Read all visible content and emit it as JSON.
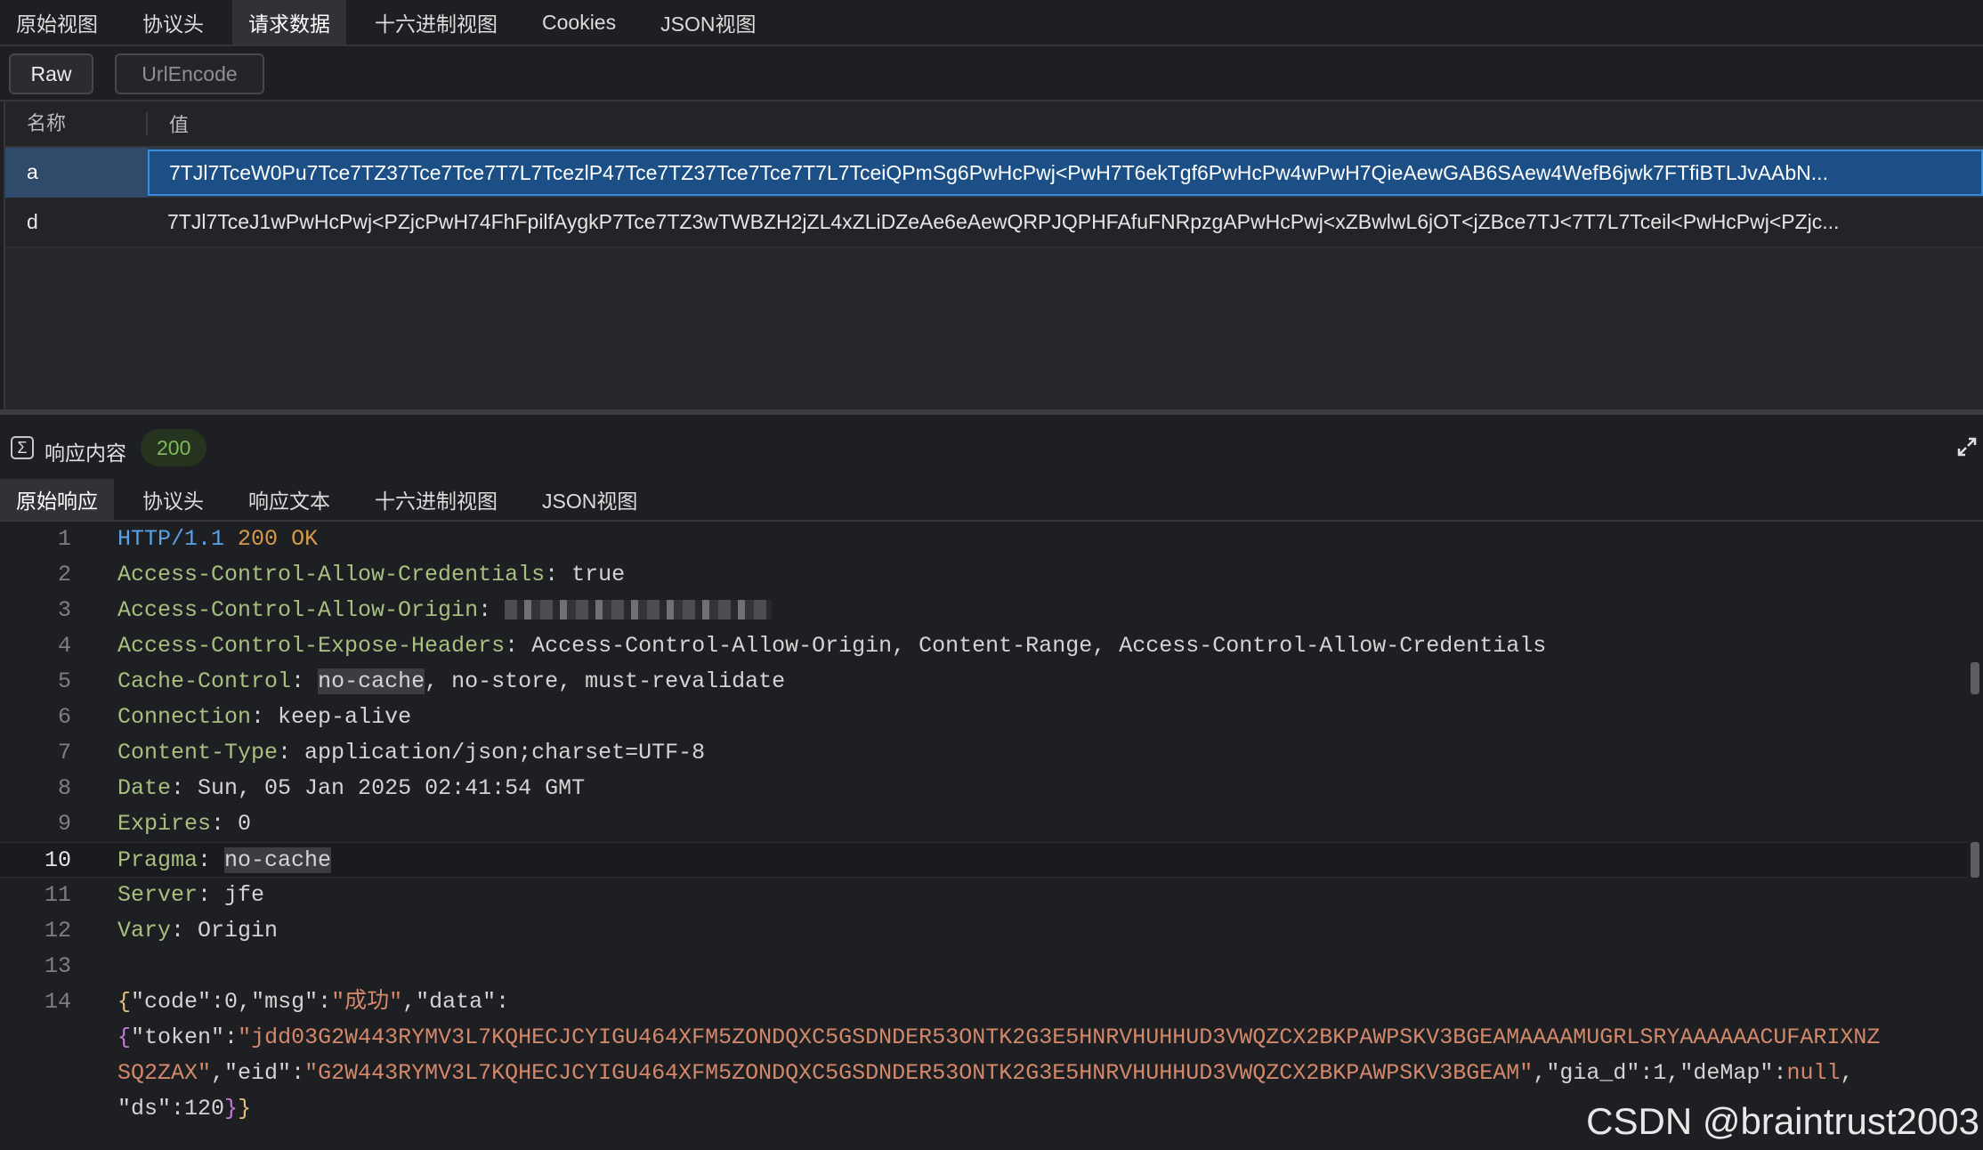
{
  "request_tabs": [
    "原始视图",
    "协议头",
    "请求数据",
    "十六进制视图",
    "Cookies",
    "JSON视图"
  ],
  "request_active_tab": "请求数据",
  "format_buttons": {
    "raw": "Raw",
    "urlencode": "UrlEncode"
  },
  "params_table": {
    "headers": {
      "name": "名称",
      "value": "值"
    },
    "rows": [
      {
        "name": "a",
        "value": "7TJl7TceW0Pu7Tce7TZ37Tce7Tce7T7L7TcezlP47Tce7TZ37Tce7Tce7T7L7TceiQPmSg6PwHcPwj<PwH7T6ekTgf6PwHcPw4wPwH7QieAewGAB6SAew4WefB6jwk7FTfiBTLJvAAbN..."
      },
      {
        "name": "d",
        "value": "7TJl7TceJ1wPwHcPwj<PZjcPwH74FhFpilfAygkP7Tce7TZ3wTWBZH2jZL4xZLiDZeAe6eAewQRPJQPHFAfuFNRpzgAPwHcPwj<xZBwlwL6jOT<jZBce7TJ<7T7L7Tceil<PwHcPwj<PZjc..."
      }
    ]
  },
  "response": {
    "title": "响应内容",
    "status_code": "200",
    "tabs": [
      "原始响应",
      "协议头",
      "响应文本",
      "十六进制视图",
      "JSON视图"
    ],
    "active_tab": "原始响应",
    "status_line": {
      "version": "HTTP/1.1",
      "code": "200",
      "reason": "OK"
    },
    "headers": [
      {
        "key": "Access-Control-Allow-Credentials",
        "value": "true"
      },
      {
        "key": "Access-Control-Allow-Origin",
        "value": ""
      },
      {
        "key": "Access-Control-Expose-Headers",
        "value": "Access-Control-Allow-Origin, Content-Range, Access-Control-Allow-Credentials"
      },
      {
        "key": "Cache-Control",
        "value_hl": "no-cache",
        "value": ", no-store, must-revalidate"
      },
      {
        "key": "Connection",
        "value": "keep-alive"
      },
      {
        "key": "Content-Type",
        "value": "application/json;charset=UTF-8"
      },
      {
        "key": "Date",
        "value": "Sun, 05 Jan 2025 02:41:54 GMT"
      },
      {
        "key": "Expires",
        "value": "0"
      },
      {
        "key": "Pragma",
        "value_hl": "no-cache",
        "value": ""
      },
      {
        "key": "Server",
        "value": "jfe"
      },
      {
        "key": "Vary",
        "value": "Origin"
      }
    ],
    "line_numbers": [
      "1",
      "2",
      "3",
      "4",
      "5",
      "6",
      "7",
      "8",
      "9",
      "10",
      "11",
      "12",
      "13",
      "14"
    ],
    "current_line": "10",
    "body": {
      "code_key": "\"code\"",
      "code_val": "0",
      "msg_key": "\"msg\"",
      "msg_val": "\"成功\"",
      "data_key": "\"data\"",
      "token_key": "\"token\"",
      "token_val_1": "\"jdd03G2W443RYMV3L7KQHECJCYIGU464XFM5ZONDQXC5GSDNDER53ONTK2G3E5HNRVHUHHUD3VWQZCX2BKPAWPSKV3BGEAMAAAAMUGRLSRYAAAAAACUFARIXNZ",
      "token_val_2": "SQ2ZAX\"",
      "eid_key": "\"eid\"",
      "eid_val": "\"G2W443RYMV3L7KQHECJCYIGU464XFM5ZONDQXC5GSDNDER53ONTK2G3E5HNRVHUHHUD3VWQZCX2BKPAWPSKV3BGEAM\"",
      "gia_key": "\"gia_d\"",
      "gia_val": "1",
      "demap_key": "\"deMap\"",
      "demap_val": "null",
      "ds_key": "\"ds\"",
      "ds_val": "120"
    }
  },
  "watermark": "CSDN @braintrust2003"
}
